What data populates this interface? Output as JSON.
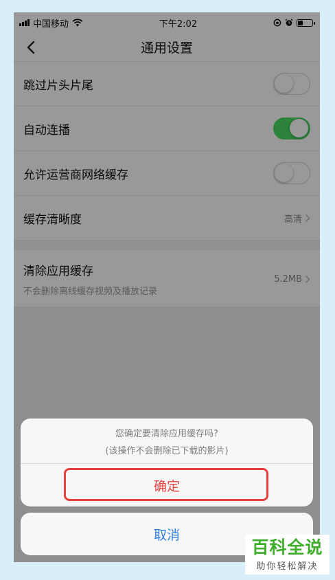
{
  "status_bar": {
    "carrier": "中国移动",
    "time": "下午2:02"
  },
  "nav": {
    "title": "通用设置"
  },
  "settings": {
    "skip_intro_outro": {
      "label": "跳过片头片尾",
      "enabled": false
    },
    "autoplay": {
      "label": "自动连播",
      "enabled": true
    },
    "allow_carrier_cache": {
      "label": "允许运营商网络缓存",
      "enabled": false
    },
    "cache_quality": {
      "label": "缓存清晰度",
      "value": "高清"
    },
    "clear_cache": {
      "label": "清除应用缓存",
      "subtitle": "不会删除离线缓存视频及播放记录",
      "value": "5.2MB"
    }
  },
  "dialog": {
    "line1": "您确定要清除应用缓存吗?",
    "line2": "(该操作不会删除已下载的影片)",
    "confirm_label": "确定",
    "cancel_label": "取消"
  },
  "watermark": {
    "title": "百科全说",
    "subtitle": "助你轻松解决"
  },
  "colors": {
    "toggle_on": "#4cd964",
    "confirm": "#e64340",
    "cancel": "#2f7fe0",
    "highlight_box": "#e8413b",
    "watermark_green": "#3fae2c"
  }
}
